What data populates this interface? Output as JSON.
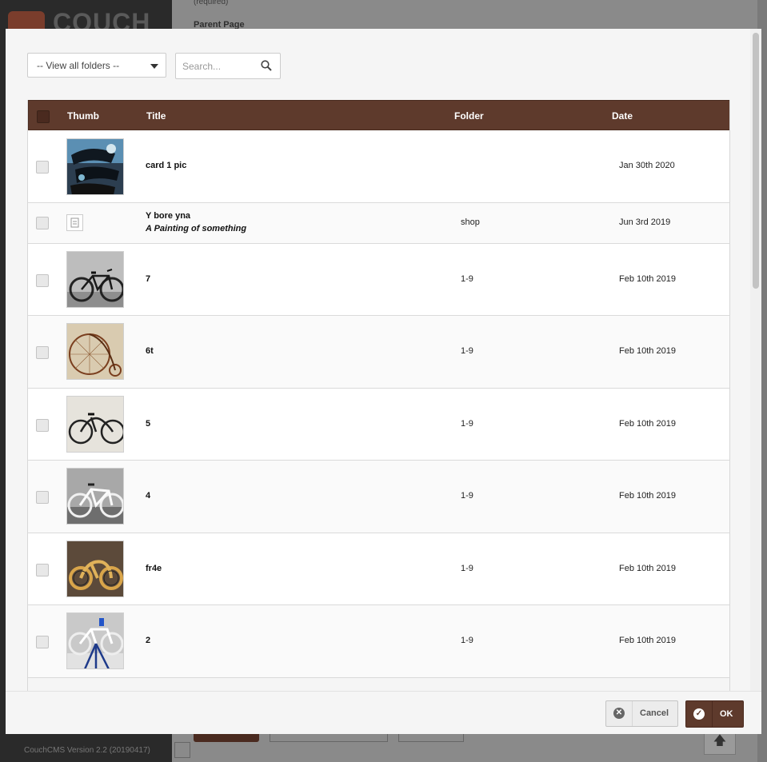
{
  "background": {
    "logo_text": "COUCH",
    "required_note": "(required)",
    "parent_page_label": "Parent Page",
    "version": "CouchCMS Version 2.2 (20190417)",
    "scroll_top_icon": "arrow-up-icon"
  },
  "toolbar": {
    "folder_select_value": "-- View all folders --",
    "search_placeholder": "Search...",
    "search_icon": "search-icon"
  },
  "table": {
    "columns": {
      "thumb": "Thumb",
      "title": "Title",
      "folder": "Folder",
      "date": "Date"
    },
    "rows": [
      {
        "title": "card 1 pic",
        "subtitle": "",
        "folder": "",
        "date": "Jan 30th 2020",
        "thumb": "abstract-painting"
      },
      {
        "title": "Y bore yna",
        "subtitle": "A Painting of something",
        "folder": "shop",
        "date": "Jun 3rd 2019",
        "thumb": "file-placeholder-icon"
      },
      {
        "title": "7",
        "subtitle": "",
        "folder": "1-9",
        "date": "Feb 10th 2019",
        "thumb": "bicycle-photo"
      },
      {
        "title": "6t",
        "subtitle": "",
        "folder": "1-9",
        "date": "Feb 10th 2019",
        "thumb": "penny-farthing-photo"
      },
      {
        "title": "5",
        "subtitle": "",
        "folder": "1-9",
        "date": "Feb 10th 2019",
        "thumb": "bicycle-photo"
      },
      {
        "title": "4",
        "subtitle": "",
        "folder": "1-9",
        "date": "Feb 10th 2019",
        "thumb": "bicycle-photo"
      },
      {
        "title": "fr4e",
        "subtitle": "",
        "folder": "1-9",
        "date": "Feb 10th 2019",
        "thumb": "wooden-bicycle-photo"
      },
      {
        "title": "2",
        "subtitle": "",
        "folder": "1-9",
        "date": "Feb 10th 2019",
        "thumb": "bicycle-stand-photo"
      }
    ]
  },
  "footer": {
    "cancel_label": "Cancel",
    "ok_label": "OK",
    "cancel_icon": "close-circle-icon",
    "ok_icon": "check-circle-icon"
  },
  "colors": {
    "accent": "#5e3a2c"
  }
}
